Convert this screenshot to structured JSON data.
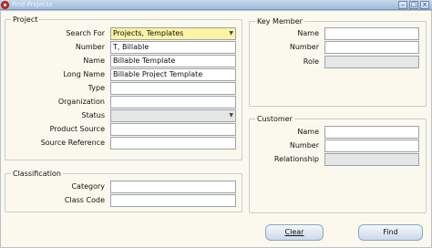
{
  "window": {
    "title": "Find Projects"
  },
  "project": {
    "heading": "Project",
    "search_for": {
      "label": "Search For",
      "value": "Projects, Templates"
    },
    "number": {
      "label": "Number",
      "value": "T, Billable"
    },
    "name": {
      "label": "Name",
      "value": "Billable Template"
    },
    "long_name": {
      "label": "Long Name",
      "value": "Billable Project Template"
    },
    "type": {
      "label": "Type",
      "value": ""
    },
    "organization": {
      "label": "Organization",
      "value": ""
    },
    "status": {
      "label": "Status",
      "value": ""
    },
    "product_source": {
      "label": "Product Source",
      "value": ""
    },
    "source_reference": {
      "label": "Source Reference",
      "value": ""
    }
  },
  "classification": {
    "heading": "Classification",
    "category": {
      "label": "Category",
      "value": ""
    },
    "class_code": {
      "label": "Class Code",
      "value": ""
    }
  },
  "key_member": {
    "heading": "Key Member",
    "name": {
      "label": "Name",
      "value": ""
    },
    "number": {
      "label": "Number",
      "value": ""
    },
    "role": {
      "label": "Role",
      "value": ""
    }
  },
  "customer": {
    "heading": "Customer",
    "name": {
      "label": "Name",
      "value": ""
    },
    "number": {
      "label": "Number",
      "value": ""
    },
    "relationship": {
      "label": "Relationship",
      "value": ""
    }
  },
  "buttons": {
    "clear": "Clear",
    "find": "Find"
  },
  "icons": {
    "app": "oracle-icon",
    "dropdown": "chevron-down-icon"
  },
  "colors": {
    "titlebar": "#9fbcdc",
    "background": "#fbf9ee",
    "required_field": "#fdf3a4",
    "disabled_field": "#e5e7e7"
  }
}
